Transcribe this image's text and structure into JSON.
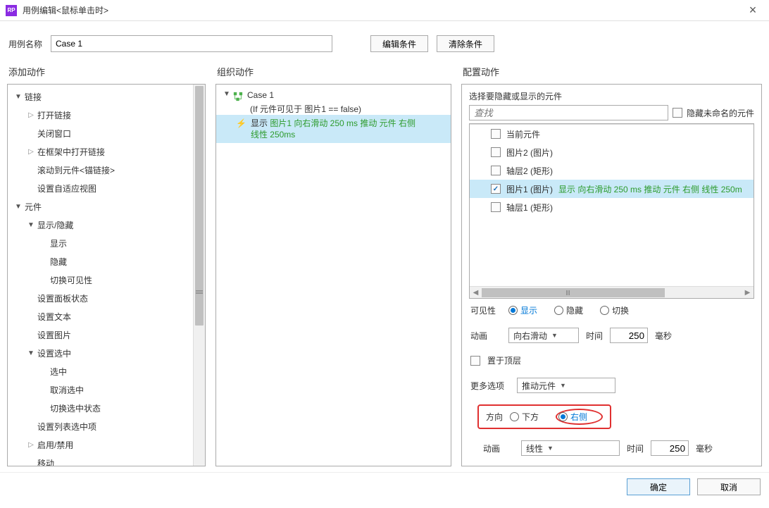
{
  "window": {
    "app_icon": "RP",
    "title": "用例编辑<鼠标单击时>",
    "close": "×"
  },
  "name_row": {
    "label": "用例名称",
    "value": "Case 1",
    "edit_btn": "编辑条件",
    "clear_btn": "清除条件"
  },
  "columns": {
    "c1": "添加动作",
    "c2": "组织动作",
    "c3": "配置动作"
  },
  "tree": {
    "items": [
      {
        "i": 0,
        "tri": "open",
        "label": "链接"
      },
      {
        "i": 1,
        "tri": "closed",
        "label": "打开链接"
      },
      {
        "i": 1,
        "tri": "none",
        "label": "关闭窗口"
      },
      {
        "i": 1,
        "tri": "closed",
        "label": "在框架中打开链接"
      },
      {
        "i": 1,
        "tri": "none",
        "label": "滚动到元件<锚链接>"
      },
      {
        "i": 1,
        "tri": "none",
        "label": "设置自适应视图"
      },
      {
        "i": 0,
        "tri": "open",
        "label": "元件"
      },
      {
        "i": 1,
        "tri": "open",
        "label": "显示/隐藏"
      },
      {
        "i": 2,
        "tri": "none",
        "label": "显示"
      },
      {
        "i": 2,
        "tri": "none",
        "label": "隐藏"
      },
      {
        "i": 2,
        "tri": "none",
        "label": "切换可见性"
      },
      {
        "i": 1,
        "tri": "none",
        "label": "设置面板状态"
      },
      {
        "i": 1,
        "tri": "none",
        "label": "设置文本"
      },
      {
        "i": 1,
        "tri": "none",
        "label": "设置图片"
      },
      {
        "i": 1,
        "tri": "open",
        "label": "设置选中"
      },
      {
        "i": 2,
        "tri": "none",
        "label": "选中"
      },
      {
        "i": 2,
        "tri": "none",
        "label": "取消选中"
      },
      {
        "i": 2,
        "tri": "none",
        "label": "切换选中状态"
      },
      {
        "i": 1,
        "tri": "none",
        "label": "设置列表选中项"
      },
      {
        "i": 1,
        "tri": "closed",
        "label": "启用/禁用"
      },
      {
        "i": 1,
        "tri": "none",
        "label": "移动"
      }
    ]
  },
  "case": {
    "name": "Case 1",
    "condition": "(If 元件可见于 图片1 == false)",
    "action_prefix": "显示",
    "action_green1": "图片1 向右滑动 250 ms 推动 元件 右侧",
    "action_green2": "线性 250ms"
  },
  "config": {
    "header": "选择要隐藏或显示的元件",
    "search_placeholder": "查找",
    "hide_unnamed": "隐藏未命名的元件",
    "widgets": [
      {
        "checked": false,
        "label": "当前元件"
      },
      {
        "checked": false,
        "label": "图片2 (图片)"
      },
      {
        "checked": false,
        "label": "轴层2 (矩形)"
      },
      {
        "checked": true,
        "label": "图片1 (图片)",
        "extra": "显示 向右滑动 250 ms 推动 元件 右侧 线性 250m"
      },
      {
        "checked": false,
        "label": "轴层1 (矩形)"
      }
    ],
    "vis_label": "可见性",
    "vis_show": "显示",
    "vis_hide": "隐藏",
    "vis_toggle": "切换",
    "anim_label": "动画",
    "anim_value": "向右滑动",
    "time_label": "时间",
    "time_value": "250",
    "ms": "毫秒",
    "bring_front": "置于顶层",
    "more_label": "更多选项",
    "more_value": "推动元件",
    "dir_label": "方向",
    "dir_down": "下方",
    "dir_right": "右侧",
    "anim2_label": "动画",
    "anim2_value": "线性",
    "time2_label": "时间",
    "time2_value": "250",
    "ms2": "毫秒"
  },
  "footer": {
    "ok": "确定",
    "cancel": "取消"
  }
}
